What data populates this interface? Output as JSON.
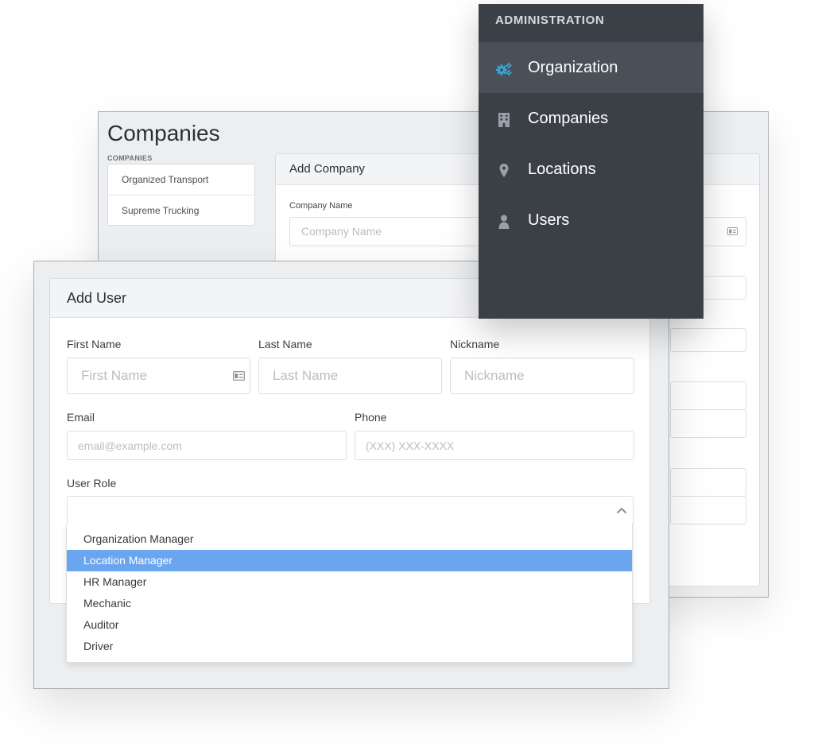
{
  "companies_window": {
    "title": "Companies",
    "section_label": "COMPANIES",
    "companies": [
      "Organized Transport",
      "Supreme Trucking"
    ],
    "add_company": {
      "header": "Add Company",
      "company_name_label": "Company Name",
      "company_name_placeholder": "Company Name",
      "field_icon": "id-card-icon"
    }
  },
  "add_user_window": {
    "header": "Add User",
    "first_name": {
      "label": "First Name",
      "placeholder": "First Name",
      "icon": "id-card-icon"
    },
    "last_name": {
      "label": "Last Name",
      "placeholder": "Last Name"
    },
    "nickname": {
      "label": "Nickname",
      "placeholder": "Nickname"
    },
    "email": {
      "label": "Email",
      "placeholder": "email@example.com"
    },
    "phone": {
      "label": "Phone",
      "placeholder": "(XXX) XXX-XXXX"
    },
    "user_role": {
      "label": "User Role",
      "expanded_icon": "chevron-up-icon",
      "options": [
        "Organization Manager",
        "Location Manager",
        "HR Manager",
        "Mechanic",
        "Auditor",
        "Driver"
      ],
      "highlighted_option": "Location Manager"
    }
  },
  "admin_nav": {
    "heading": "ADMINISTRATION",
    "items": [
      {
        "label": "Organization",
        "icon": "cogs-icon",
        "active": true
      },
      {
        "label": "Companies",
        "icon": "building-icon",
        "active": false
      },
      {
        "label": "Locations",
        "icon": "map-marker-icon",
        "active": false
      },
      {
        "label": "Users",
        "icon": "user-icon",
        "active": false
      }
    ]
  },
  "colors": {
    "nav_background": "#3b4047",
    "nav_active": "#4a5058",
    "nav_icon_active": "#3aa4d8",
    "highlight": "#6aa5ef"
  }
}
